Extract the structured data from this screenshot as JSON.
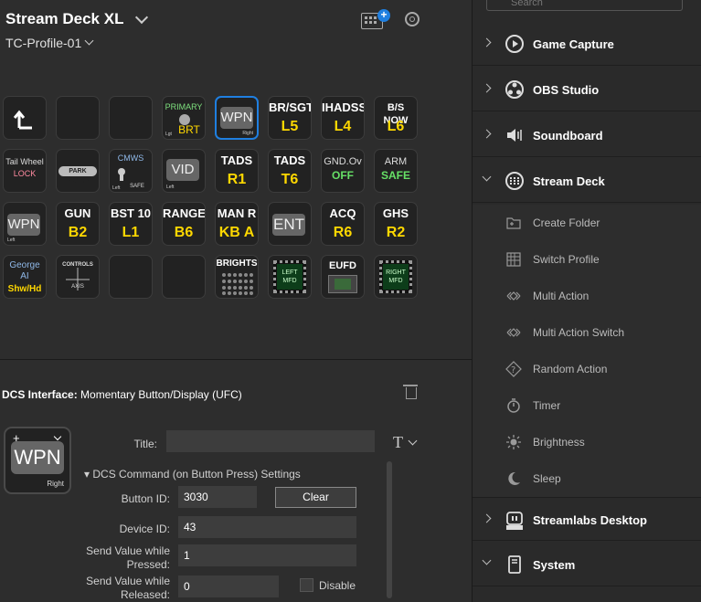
{
  "header": {
    "device_title": "Stream Deck XL",
    "profile": "TC-Profile-01"
  },
  "keys": [
    {
      "title": "",
      "value": ""
    },
    {
      "title": "",
      "value": ""
    },
    {
      "title": "",
      "value": ""
    },
    {
      "title": "PRIMARY",
      "value": "BRT",
      "sub": "Lgt"
    },
    {
      "title": "WPN",
      "sub": "Right"
    },
    {
      "title": "BR/SGT",
      "value": "L5"
    },
    {
      "title": "IHADSS",
      "value": "L4"
    },
    {
      "title": "B/S NOW",
      "value": "L6"
    },
    {
      "title": "Tail Wheel",
      "value": "LOCK"
    },
    {
      "title": "PARK BRAKE"
    },
    {
      "title": "CMWS",
      "value": "SAFE",
      "sub": "Left"
    },
    {
      "title": "VID",
      "sub": "Left"
    },
    {
      "title": "TADS",
      "value": "R1"
    },
    {
      "title": "TADS",
      "value": "T6"
    },
    {
      "title": "GND.Ov",
      "value": "OFF"
    },
    {
      "title": "ARM",
      "value": "SAFE"
    },
    {
      "title": "WPN",
      "sub": "Left"
    },
    {
      "title": "GUN",
      "value": "B2"
    },
    {
      "title": "BST 10",
      "value": "L1"
    },
    {
      "title": "RANGE",
      "value": "B6"
    },
    {
      "title": "MAN R",
      "value": "KB A"
    },
    {
      "title": "ENT"
    },
    {
      "title": "ACQ",
      "value": "R6"
    },
    {
      "title": "GHS",
      "value": "R2"
    },
    {
      "title": "George AI",
      "value": "Shw/Hd"
    },
    {
      "title": "CONTROLS",
      "value": "AXIS"
    },
    {
      "title": ""
    },
    {
      "title": ""
    },
    {
      "title": "BRIGHTS"
    },
    {
      "title": "LEFT MFD"
    },
    {
      "title": "EUFD"
    },
    {
      "title": "RIGHT MFD"
    }
  ],
  "inspector": {
    "plugin": "DCS Interface:",
    "action": "Momentary Button/Display (UFC)",
    "preview_label": "WPN",
    "preview_sub": "Right",
    "title_label": "Title:",
    "section": "DCS Command (on Button Press) Settings",
    "button_id_label": "Button ID:",
    "button_id": "3030",
    "clear": "Clear",
    "device_id_label": "Device ID:",
    "device_id": "43",
    "send_pressed_label_1": "Send Value while",
    "send_pressed_label_2": "Pressed:",
    "send_pressed": "1",
    "send_released_label_1": "Send Value while",
    "send_released_label_2": "Released:",
    "send_released": "0",
    "disable": "Disable"
  },
  "sidebar": {
    "search_placeholder": "Search",
    "categories": {
      "game_capture": "Game Capture",
      "obs": "OBS Studio",
      "soundboard": "Soundboard",
      "stream_deck": "Stream Deck",
      "streamlabs": "Streamlabs Desktop",
      "system": "System"
    },
    "actions": {
      "create_folder": "Create Folder",
      "switch_profile": "Switch Profile",
      "multi_action": "Multi Action",
      "multi_action_switch": "Multi Action Switch",
      "random_action": "Random Action",
      "timer": "Timer",
      "brightness": "Brightness",
      "sleep": "Sleep"
    }
  }
}
